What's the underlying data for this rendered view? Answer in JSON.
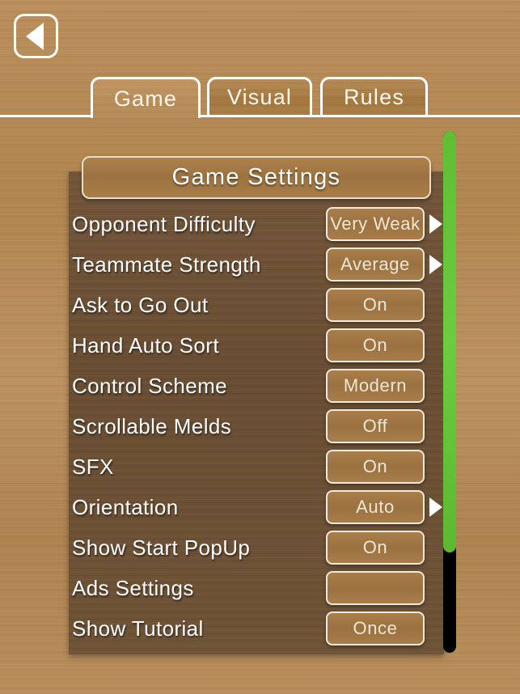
{
  "nav": {
    "back_label": "Back",
    "back_icon": "left-triangle-icon"
  },
  "tabs": [
    {
      "id": "game",
      "label": "Game",
      "active": true
    },
    {
      "id": "visual",
      "label": "Visual",
      "active": false
    },
    {
      "id": "rules",
      "label": "Rules",
      "active": false
    }
  ],
  "panel": {
    "title": "Game Settings",
    "rows": [
      {
        "label": "Opponent Difficulty",
        "value": "Very Weak",
        "arrow": true
      },
      {
        "label": "Teammate Strength",
        "value": "Average",
        "arrow": true
      },
      {
        "label": "Ask to Go Out",
        "value": "On",
        "arrow": false
      },
      {
        "label": "Hand Auto Sort",
        "value": "On",
        "arrow": false
      },
      {
        "label": "Control Scheme",
        "value": "Modern",
        "arrow": false
      },
      {
        "label": "Scrollable Melds",
        "value": "Off",
        "arrow": false
      },
      {
        "label": "SFX",
        "value": "On",
        "arrow": false
      },
      {
        "label": "Orientation",
        "value": "Auto",
        "arrow": true
      },
      {
        "label": "Show Start PopUp",
        "value": "On",
        "arrow": false
      },
      {
        "label": "Ads Settings",
        "value": "",
        "arrow": false
      },
      {
        "label": "Show Tutorial",
        "value": "Once",
        "arrow": false
      }
    ]
  },
  "scrollbar": {
    "thumb_color": "#66c437",
    "track_color": "#000000",
    "position_percent": 0
  },
  "colors": {
    "wood_background": "#b78c59",
    "panel_background": "#6d5136",
    "button_fill": "#a97e4b",
    "border": "#f3eade",
    "text": "#ffffff"
  }
}
